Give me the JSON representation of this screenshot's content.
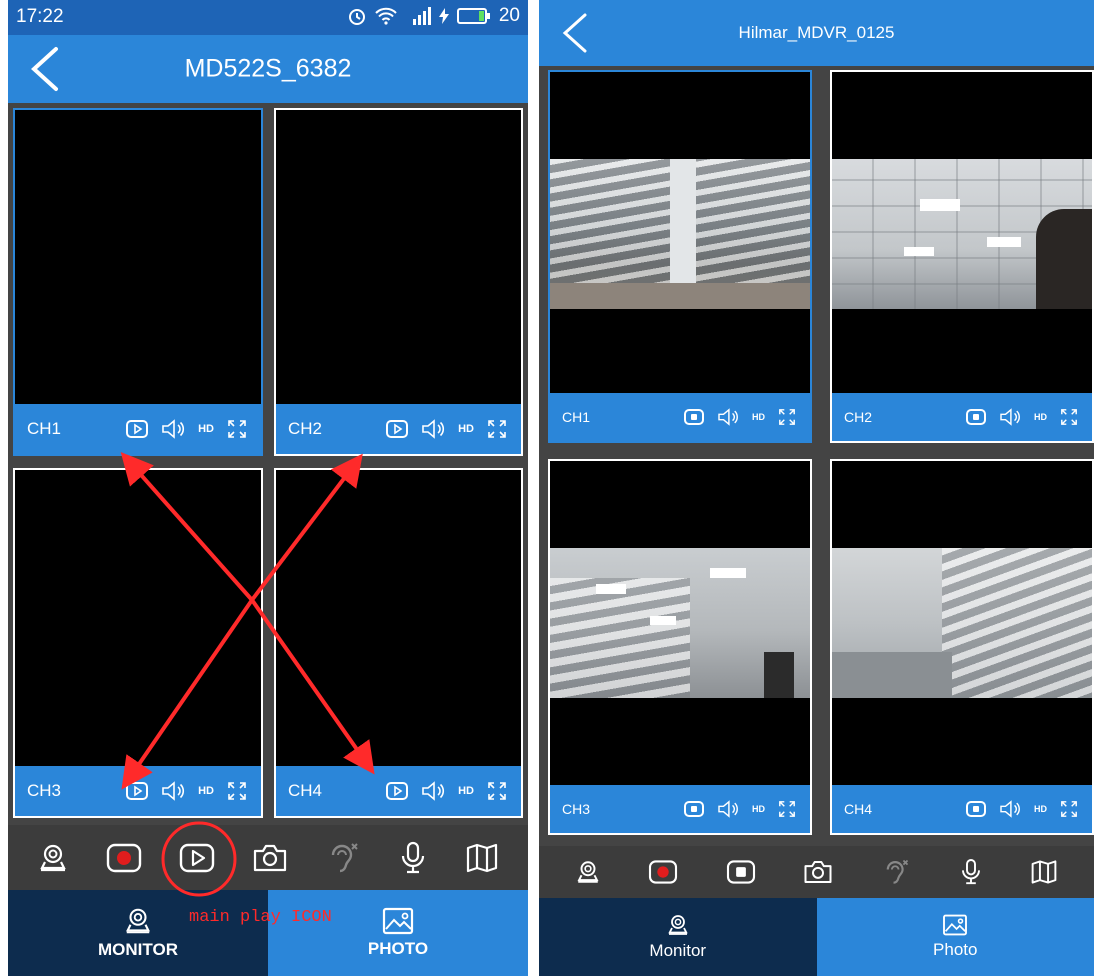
{
  "left_screen": {
    "status_bar": {
      "time": "17:22",
      "battery": "20"
    },
    "header": {
      "title": "MD522S_6382"
    },
    "channels": [
      {
        "label": "CH1",
        "hd": "HD"
      },
      {
        "label": "CH2",
        "hd": "HD"
      },
      {
        "label": "CH3",
        "hd": "HD"
      },
      {
        "label": "CH4",
        "hd": "HD"
      }
    ],
    "toolbar": [
      "monitor-icon",
      "record-icon",
      "play-icon",
      "camera-icon",
      "listen-off-icon",
      "microphone-icon",
      "map-icon"
    ],
    "nav": {
      "monitor": "MONITOR",
      "photo": "PHOTO"
    },
    "annotation": {
      "text": "main play ICON",
      "color": "#ff2a2a"
    }
  },
  "right_screen": {
    "header": {
      "title": "Hilmar_MDVR_0125"
    },
    "channels": [
      {
        "label": "CH1",
        "hd": "HD"
      },
      {
        "label": "CH2",
        "hd": "HD"
      },
      {
        "label": "CH3",
        "hd": "HD"
      },
      {
        "label": "CH4",
        "hd": "HD"
      }
    ],
    "toolbar": [
      "monitor-icon",
      "record-icon",
      "stop-icon",
      "camera-icon",
      "listen-off-icon",
      "microphone-icon",
      "map-icon"
    ],
    "nav": {
      "monitor": "Monitor",
      "photo": "Photo"
    }
  },
  "colors": {
    "primary": "#2b86d9",
    "status_bar": "#1e64b6",
    "nav_dark": "#0d2c4e",
    "toolbar": "#3c3c3c",
    "record": "#e11d1d",
    "annotation": "#ff2a2a"
  }
}
